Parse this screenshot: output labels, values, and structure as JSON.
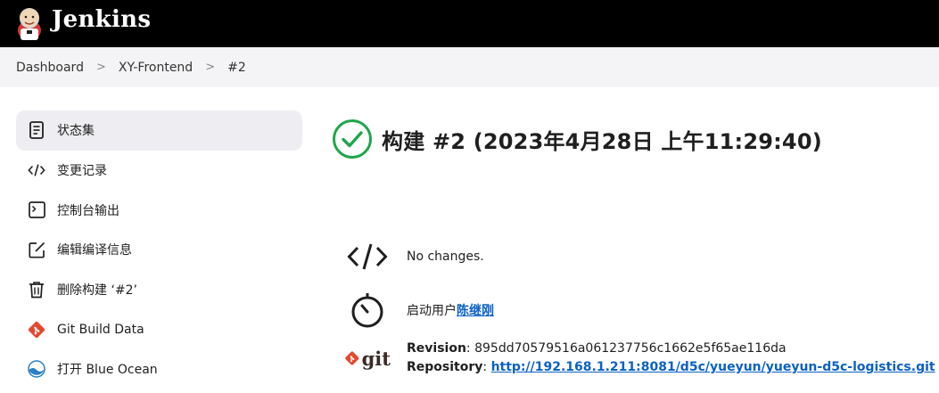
{
  "app": {
    "title": "Jenkins"
  },
  "breadcrumb": {
    "items": [
      "Dashboard",
      "XY-Frontend",
      "#2"
    ],
    "separator": ">"
  },
  "sidebar": {
    "items": [
      {
        "label": "状态集",
        "icon": "document-icon"
      },
      {
        "label": "变更记录",
        "icon": "code-icon"
      },
      {
        "label": "控制台输出",
        "icon": "terminal-icon"
      },
      {
        "label": "编辑编译信息",
        "icon": "edit-icon"
      },
      {
        "label": "删除构建 ‘#2’",
        "icon": "trash-icon"
      },
      {
        "label": "Git Build Data",
        "icon": "git-icon"
      },
      {
        "label": "打开 Blue Ocean",
        "icon": "blue-ocean-icon"
      }
    ]
  },
  "build": {
    "title": "构建 #2 (2023年4月28日 上午11:29:40)",
    "status_color": "#1ea64a",
    "changes_text": "No changes.",
    "started_by_prefix": "启动用户",
    "started_by_user": "陈继刚",
    "revision_label": "Revision",
    "revision_value": "895dd70579516a061237756c1662e5f65ae116da",
    "repository_label": "Repository",
    "repository_value": "http://192.168.1.211:8081/d5c/yueyun/yueyun-d5c-logistics.git",
    "git_logo_text": "git"
  },
  "colors": {
    "header_bg": "#000000",
    "breadcrumb_bg": "#f4f4f6",
    "link": "#0b61c4",
    "accent_git": "#e2492f"
  }
}
